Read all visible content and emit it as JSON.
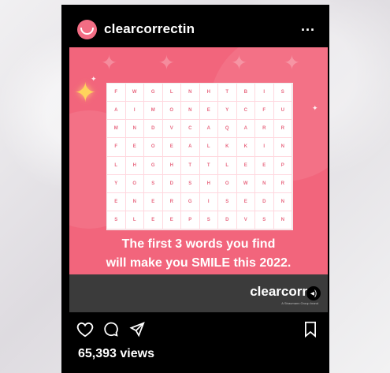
{
  "post": {
    "username": "clearcorrectin",
    "more_label": "...",
    "caption_line1": "The first 3 words you find",
    "caption_line2": "will make you SMILE this 2022.",
    "brand": "clearcorr",
    "brand_sub": "A Straumann Group brand",
    "views": "65,393 views"
  },
  "puzzle": {
    "rows": [
      [
        "F",
        "W",
        "G",
        "L",
        "N",
        "H",
        "T",
        "B",
        "I",
        "S"
      ],
      [
        "A",
        "I",
        "M",
        "O",
        "N",
        "E",
        "Y",
        "C",
        "F",
        "U"
      ],
      [
        "M",
        "N",
        "D",
        "V",
        "C",
        "A",
        "Q",
        "A",
        "R",
        "R"
      ],
      [
        "F",
        "E",
        "O",
        "E",
        "A",
        "L",
        "K",
        "K",
        "I",
        "N"
      ],
      [
        "L",
        "H",
        "G",
        "H",
        "T",
        "T",
        "L",
        "E",
        "E",
        "P"
      ],
      [
        "Y",
        "O",
        "S",
        "D",
        "S",
        "H",
        "O",
        "W",
        "N",
        "R"
      ],
      [
        "E",
        "N",
        "E",
        "R",
        "G",
        "I",
        "S",
        "E",
        "D",
        "N"
      ],
      [
        "S",
        "L",
        "E",
        "E",
        "P",
        "S",
        "D",
        "V",
        "S",
        "N"
      ]
    ]
  },
  "icons": {
    "like": "heart-icon",
    "comment": "comment-icon",
    "share": "send-icon",
    "save": "bookmark-icon",
    "mute": "sound-icon"
  }
}
